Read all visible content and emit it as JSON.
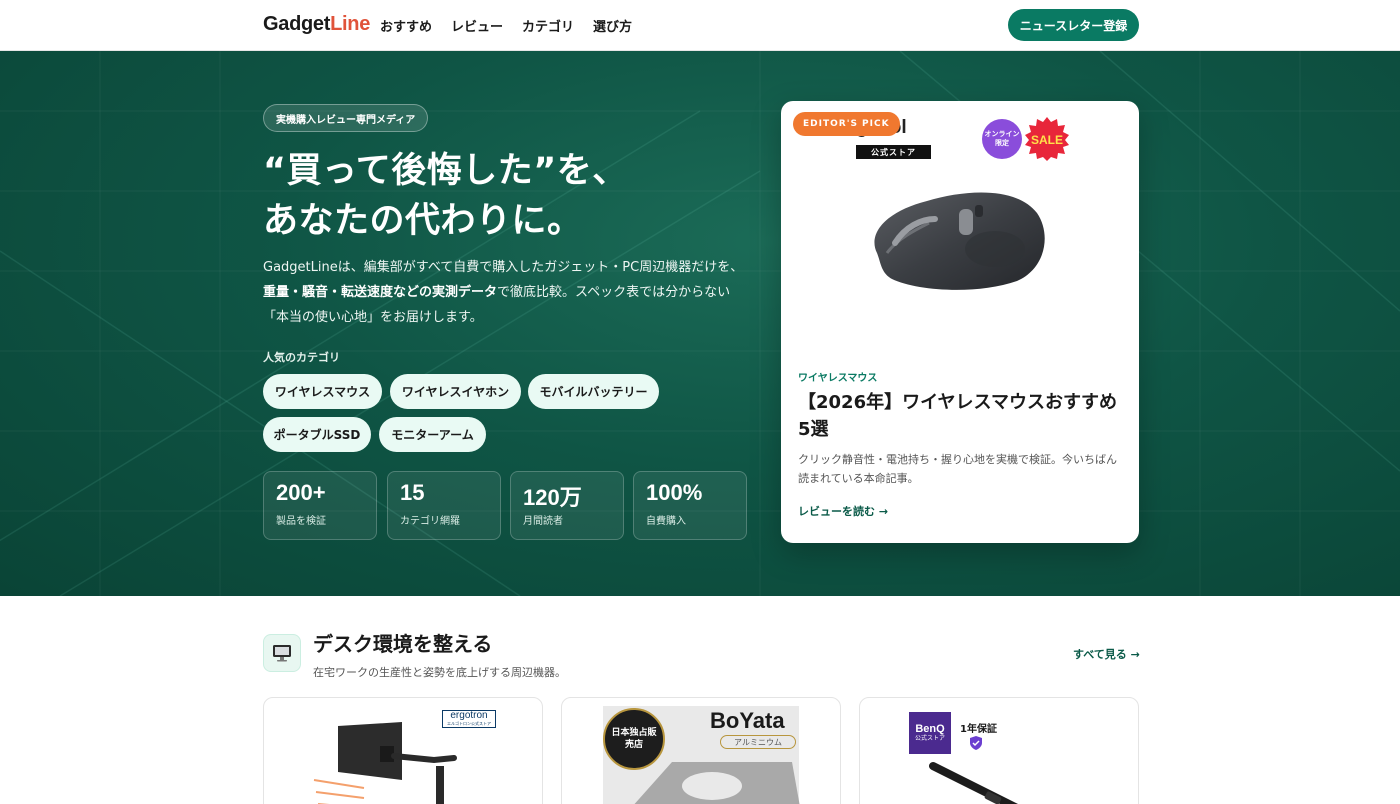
{
  "header": {
    "logo_main": "Gadget",
    "logo_accent": "Line",
    "nav": [
      "おすすめ",
      "レビュー",
      "カテゴリ",
      "選び方"
    ],
    "newsletter_button": "ニュースレター登録"
  },
  "hero": {
    "badge": "実機購入レビュー専門メディア",
    "title_line1": "“買って後悔した”を、",
    "title_line2": "あなたの代わりに。",
    "desc_part1": "GadgetLineは、編集部がすべて自費で購入したガジェット・PC周辺機器だけを、",
    "desc_bold": "重量・騒音・転送速度などの実測データ",
    "desc_part2": "で徹底比較。スペック表では分からない「本当の使い心地」をお届けします。",
    "popular_label": "人気のカテゴリ",
    "categories": [
      "ワイヤレスマウス",
      "ワイヤレスイヤホン",
      "モバイルバッテリー",
      "ポータブルSSD",
      "モニターアーム"
    ],
    "stats": [
      {
        "num": "200+",
        "label": "製品を検証"
      },
      {
        "num": "15",
        "label": "カテゴリ網羅"
      },
      {
        "num": "120万",
        "label": "月間読者"
      },
      {
        "num": "100%",
        "label": "自費購入"
      }
    ]
  },
  "feature": {
    "pick": "EDITOR'S PICK",
    "brand": "gcool",
    "store": "公式ストア",
    "online": "オンライン限定",
    "sale": "SALE",
    "category": "ワイヤレスマウス",
    "title": "【2026年】ワイヤレスマウスおすすめ5選",
    "desc": "クリック静音性・電池持ち・握り心地を実機で検証。今いちばん読まれている本命記事。",
    "read_more": "レビューを読む →"
  },
  "section": {
    "title": "デスク環境を整える",
    "subtitle": "在宅ワークの生産性と姿勢を底上げする周辺機器。",
    "see_all": "すべて見る →",
    "cards": [
      {
        "brand": "ergotron",
        "brand_sub": "エルゴトロン公式ストア"
      },
      {
        "brand": "BoYata",
        "brand_sub": "アルミニウム",
        "seal": "日本独占販売店"
      },
      {
        "brand": "BenQ",
        "brand_sub": "公式ストア",
        "warranty": "1年保証"
      }
    ]
  },
  "colors": {
    "primary": "#0a7a63",
    "hero_dark": "#0a4436",
    "accent_orange": "#f0782f",
    "logo_red": "#e0533a"
  }
}
